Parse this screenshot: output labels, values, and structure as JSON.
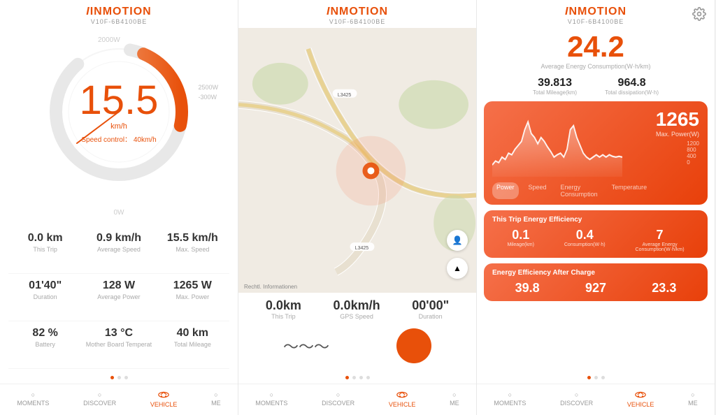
{
  "app": {
    "logo": "INMOTION",
    "subtitle": "V10F-6B4100BE"
  },
  "nav": {
    "items": [
      "MOMENTS",
      "DISCOVER",
      "VEHICLE",
      "ME"
    ],
    "active": 2
  },
  "panel1": {
    "header_power": "2000W",
    "right_labels": [
      "2500W",
      "-300W"
    ],
    "speed": "15.5",
    "speed_unit": "km/h",
    "speed_control_label": "Speed control：",
    "speed_control_value": "40km/h",
    "ow_label": "0W",
    "stats": [
      {
        "value": "0.0 km",
        "label": "This Trip"
      },
      {
        "value": "0.9 km/h",
        "label": "Average Speed"
      },
      {
        "value": "15.5 km/h",
        "label": "Max. Speed"
      },
      {
        "value": "01'40\"",
        "label": "Duration"
      },
      {
        "value": "128 W",
        "label": "Average Power"
      },
      {
        "value": "1265 W",
        "label": "Max. Power"
      },
      {
        "value": "82 %",
        "label": "Battery"
      },
      {
        "value": "13 °C",
        "label": "Mother Board Temperat"
      },
      {
        "value": "40 km",
        "label": "Total Mileage"
      }
    ]
  },
  "panel2": {
    "map_credit": "Rechtl. Informationen",
    "stats": [
      {
        "value": "0.0km",
        "label": "This Trip"
      },
      {
        "value": "0.0km/h",
        "label": "GPS Speed"
      },
      {
        "value": "00'00\"",
        "label": "Duration"
      }
    ]
  },
  "panel3": {
    "main_value": "24.2",
    "main_label": "Average Energy Consumption(W·h/km)",
    "total_mileage_value": "39.813",
    "total_mileage_label": "Total Mileage(km)",
    "total_diss_value": "964.8",
    "total_diss_label": "Total dissipation(W·h)",
    "power_card": {
      "value": "1265",
      "label": "Max. Power(W)",
      "chart_labels": [
        "1200",
        "800",
        "400",
        "0"
      ],
      "tabs": [
        "Power",
        "Speed",
        "Energy\nConsumption",
        "Temperature"
      ]
    },
    "trip_efficiency": {
      "title": "This Trip Energy Efficiency",
      "stats": [
        {
          "value": "0.1",
          "label": "Mileage(km)"
        },
        {
          "value": "0.4",
          "label": "Consumption(W·h)"
        },
        {
          "value": "7",
          "label": "Average Energy\nConsumption(W·h/km)"
        }
      ]
    },
    "after_charge": {
      "title": "Energy Efficiency After Charge",
      "stats": [
        {
          "value": "39.8",
          "label": ""
        },
        {
          "value": "927",
          "label": ""
        },
        {
          "value": "23.3",
          "label": ""
        }
      ]
    }
  }
}
